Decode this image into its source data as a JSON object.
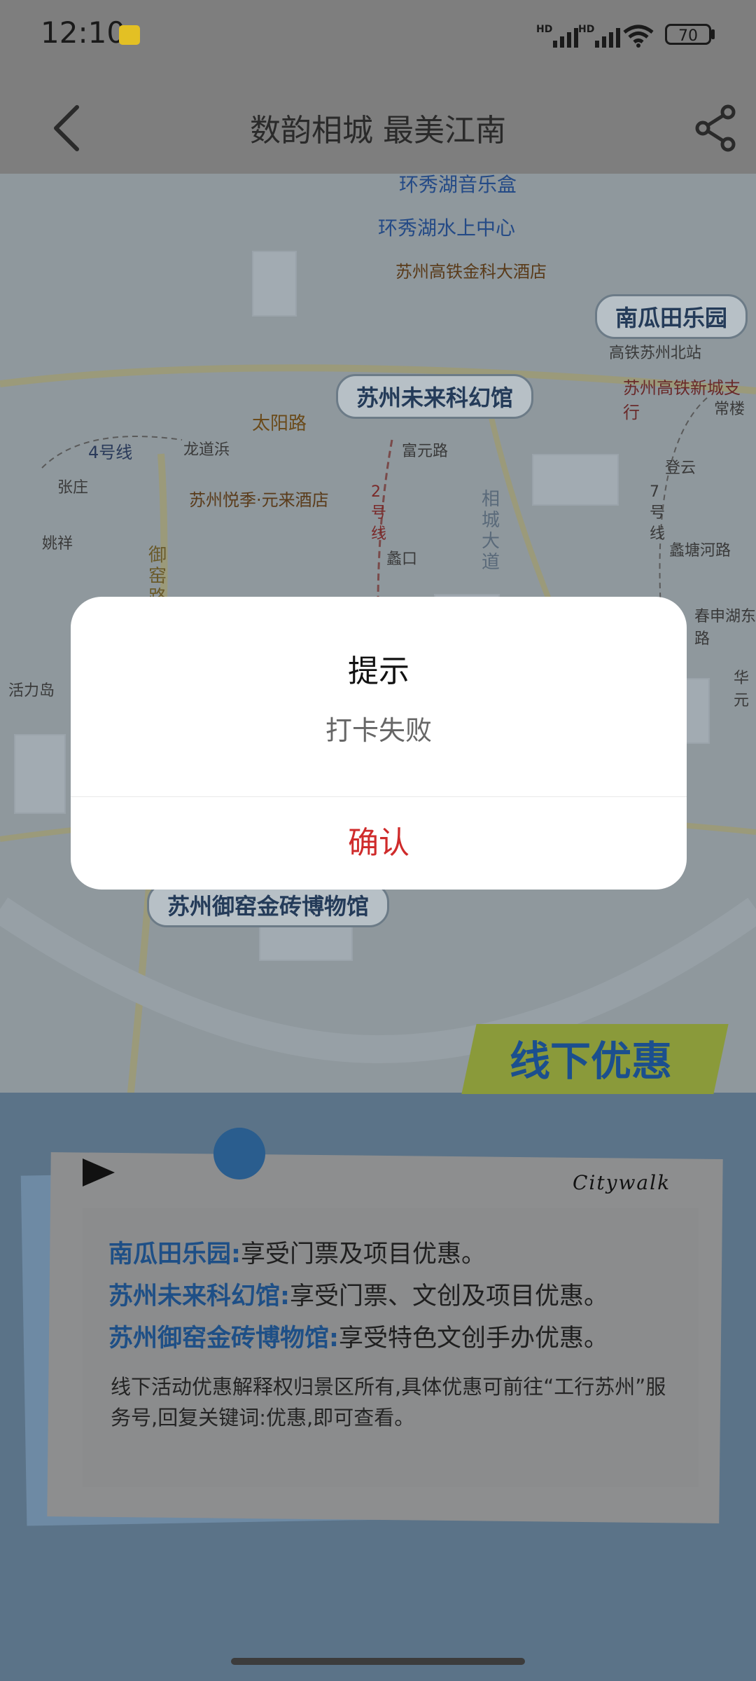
{
  "status_bar": {
    "time": "12:10",
    "network_1": "HD",
    "network_2": "HD",
    "battery": "70"
  },
  "header": {
    "title": "数韵相城 最美江南",
    "back_icon": "chevron-left-icon",
    "share_icon": "share-icon"
  },
  "map": {
    "pois": [
      "环秀湖音乐盒",
      "环秀湖水上中心",
      "苏州高铁金科大酒店",
      "南瓜田乐园",
      "苏州未来科幻馆",
      "苏州高铁新城支行",
      "苏州悦季·元来酒店",
      "苏州御窑金砖博物馆"
    ],
    "roads": {
      "taiyang": "太阳路",
      "xiangcheng": "相城大道",
      "yuyao": "御窑路"
    },
    "metro": {
      "line4": "4号线",
      "line2": "2号线",
      "line7": "7号线"
    },
    "stations": {
      "longdao": "龙道浜",
      "fuyuan": "富元路",
      "zhangzhuang": "张庄",
      "yaoxiang": "姚祥",
      "likou": "蠡口",
      "huolidao": "活力岛",
      "gaotie": "高铁苏州北站",
      "changlou": "常楼",
      "dengyun": "登云",
      "lixiang": "蠡塘河路",
      "chunshen": "春申湖东路",
      "huayuan": "华元"
    }
  },
  "promo": {
    "badge": "线下优惠",
    "citywalk": "Citywalk",
    "benefits": [
      {
        "name": "南瓜田乐园:",
        "text": "享受门票及项目优惠。"
      },
      {
        "name": "苏州未来科幻馆:",
        "text": "享受门票、文创及项目优惠。"
      },
      {
        "name": "苏州御窑金砖博物馆:",
        "text": "享受特色文创手办优惠。"
      }
    ],
    "note": "线下活动优惠解释权归景区所有,具体优惠可前往“工行苏州”服务号,回复关键词:优惠,即可查看。"
  },
  "dialog": {
    "title": "提示",
    "message": "打卡失败",
    "confirm": "确认"
  }
}
